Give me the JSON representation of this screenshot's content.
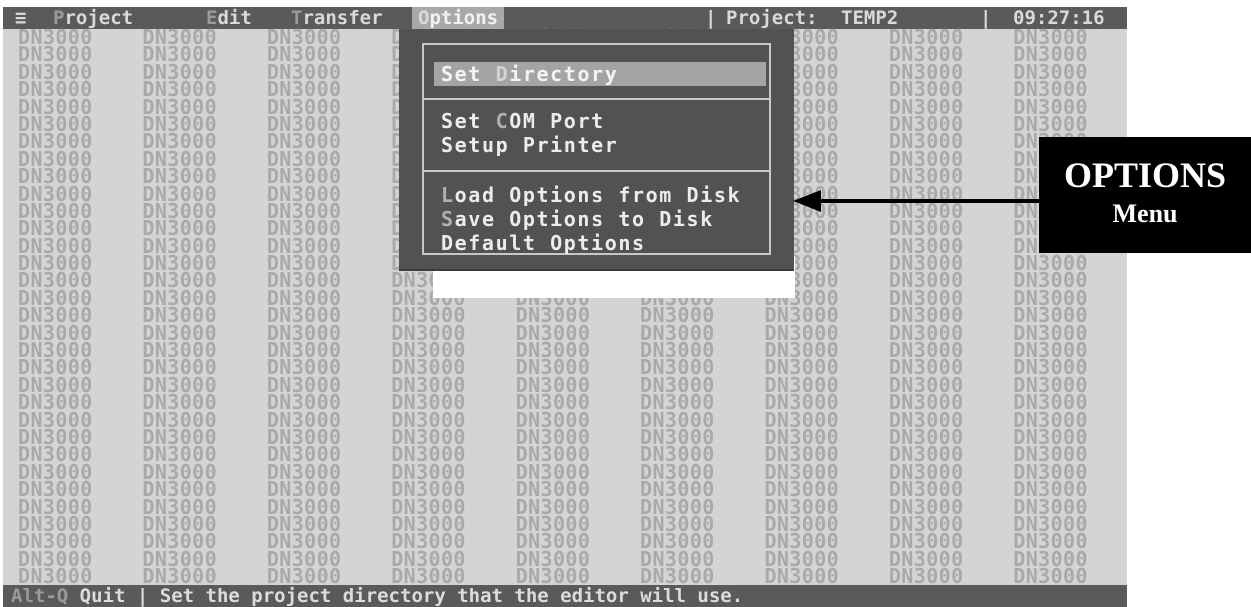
{
  "menubar": {
    "system_glyph": "≡",
    "items": [
      {
        "hotkey": "P",
        "rest": "roject"
      },
      {
        "hotkey": "E",
        "rest": "dit"
      },
      {
        "hotkey": "T",
        "rest": "ransfer"
      },
      {
        "hotkey": "O",
        "rest": "ptions"
      }
    ],
    "active_index": 3,
    "project_label": "Project:",
    "project_name": "TEMP2",
    "clock": "09:27:16",
    "separator": "|"
  },
  "background": {
    "cell_text": "DN3000",
    "columns": 10,
    "rows": 32
  },
  "options_menu": {
    "items": [
      {
        "hotkey": "",
        "pre": "Set ",
        "hk": "D",
        "post": "irectory",
        "selected": true
      },
      {
        "pre": "Set ",
        "hk": "C",
        "post": "OM Port",
        "selected": false
      },
      {
        "pre": "Set",
        "hk": "u",
        "post": "p Printer",
        "selected": false
      },
      {
        "pre": "",
        "hk": "L",
        "post": "oad Options from Disk",
        "selected": false
      },
      {
        "pre": "",
        "hk": "S",
        "post": "ave Options to Disk",
        "selected": false
      },
      {
        "pre": "Default Options",
        "hk": "",
        "post": "",
        "selected": false
      }
    ]
  },
  "statusbar": {
    "hint_hotkey": "Alt-Q",
    "hint_label": "Quit",
    "separator": "|",
    "message": "Set the project directory that the editor will use."
  },
  "callout": {
    "title": "OPTIONS",
    "subtitle": "Menu"
  },
  "colors": {
    "bar": "#5a5a5a",
    "screen": "#d4d4d4",
    "menu": "#525252",
    "highlight": "#a4a4a4",
    "callout": "#000000"
  }
}
